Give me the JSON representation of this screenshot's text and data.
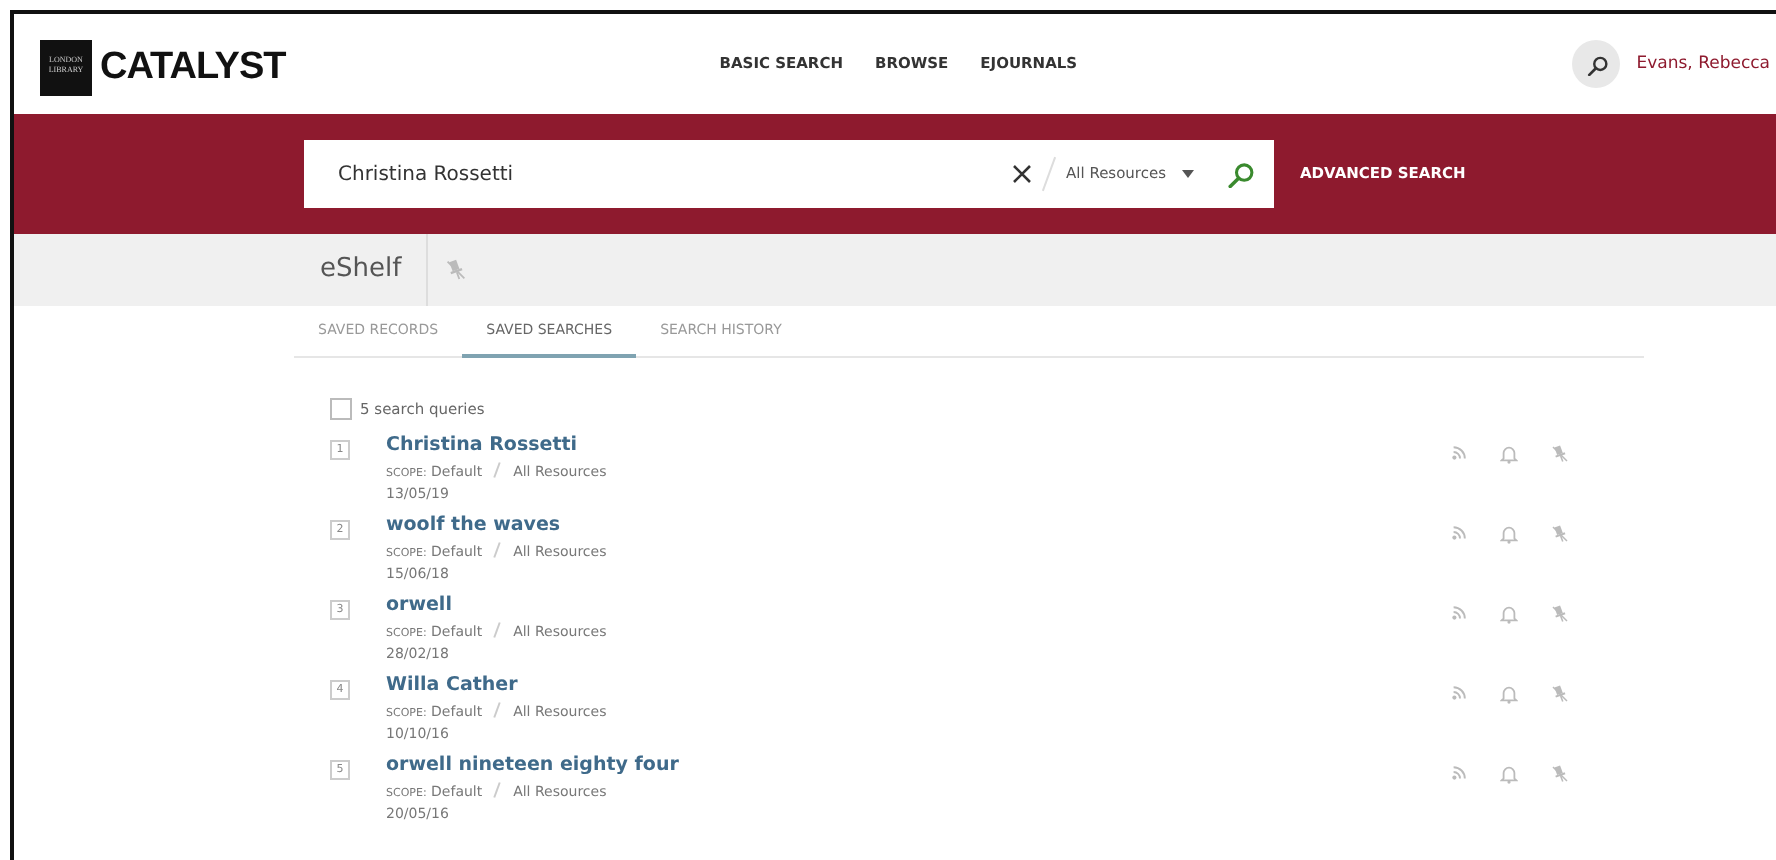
{
  "header": {
    "logo_small": "LONDON LIBRARY",
    "logo": "CATALYST",
    "nav": [
      "BASIC SEARCH",
      "BROWSE",
      "EJOURNALS"
    ],
    "user": "Evans, Rebecca"
  },
  "search": {
    "value": "Christina Rossetti",
    "scope": "All Resources",
    "advanced": "ADVANCED SEARCH"
  },
  "eshelf": {
    "title": "eShelf"
  },
  "tabs": [
    {
      "label": "SAVED RECORDS",
      "selected": false
    },
    {
      "label": "SAVED SEARCHES",
      "selected": true
    },
    {
      "label": "SEARCH HISTORY",
      "selected": false
    }
  ],
  "select_all": {
    "label": "5 search queries",
    "checked": false
  },
  "queries": [
    {
      "index": "1",
      "title": "Christina Rossetti",
      "scope_label": "SCOPE:",
      "scope": "Default",
      "collection": "All Resources",
      "date": "13/05/19"
    },
    {
      "index": "2",
      "title": "woolf the waves",
      "scope_label": "SCOPE:",
      "scope": "Default",
      "collection": "All Resources",
      "date": "15/06/18"
    },
    {
      "index": "3",
      "title": "orwell",
      "scope_label": "SCOPE:",
      "scope": "Default",
      "collection": "All Resources",
      "date": "28/02/18"
    },
    {
      "index": "4",
      "title": "Willa Cather",
      "scope_label": "SCOPE:",
      "scope": "Default",
      "collection": "All Resources",
      "date": "10/10/16"
    },
    {
      "index": "5",
      "title": "orwell nineteen eighty four",
      "scope_label": "SCOPE:",
      "scope": "Default",
      "collection": "All Resources",
      "date": "20/05/16"
    }
  ]
}
